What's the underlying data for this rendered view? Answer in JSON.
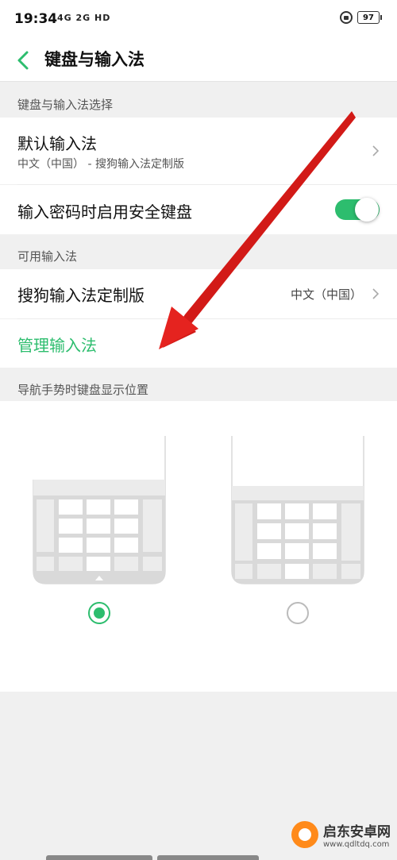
{
  "status_bar": {
    "time": "19:34",
    "signal_text": "4G 2G HD",
    "battery": "97"
  },
  "header": {
    "title": "键盘与输入法"
  },
  "sections": {
    "keyboard_select_header": "键盘与输入法选择",
    "available_header": "可用输入法",
    "nav_gesture_header": "导航手势时键盘显示位置"
  },
  "default_ime": {
    "title": "默认输入法",
    "subtitle": "中文（中国） - 搜狗输入法定制版"
  },
  "secure_keyboard": {
    "label": "输入密码时启用安全键盘",
    "enabled": true
  },
  "sogou_ime": {
    "title": "搜狗输入法定制版",
    "value": "中文（中国）"
  },
  "manage_ime": {
    "label": "管理输入法"
  },
  "keyboard_position": {
    "options": [
      {
        "selected": true
      },
      {
        "selected": false
      }
    ]
  },
  "watermark": {
    "name": "启东安卓网",
    "url": "www.qdltdq.com"
  },
  "colors": {
    "accent": "#2dbd6e",
    "arrow": "#e5231f"
  }
}
